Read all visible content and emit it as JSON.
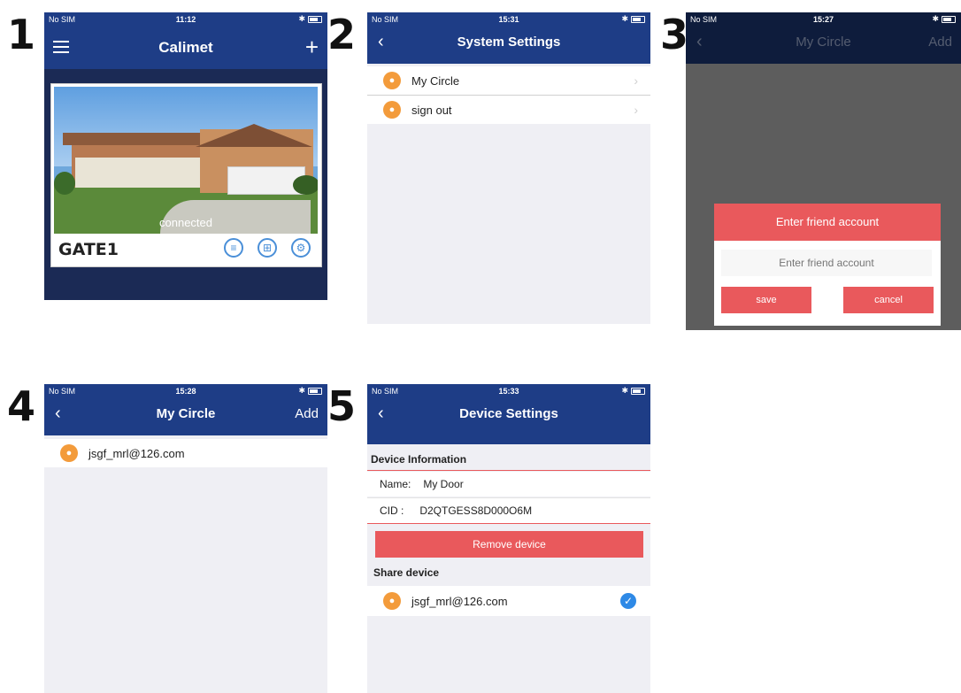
{
  "labels": [
    "1",
    "2",
    "3",
    "4",
    "5"
  ],
  "status": {
    "carrier": "No SIM",
    "time1": "11:12",
    "time2": "15:31",
    "time3": "15:27",
    "time4": "15:28",
    "time5": "15:33"
  },
  "screen1": {
    "title": "Calimet",
    "camera_status": "connected",
    "device_name": "GATE1"
  },
  "screen2": {
    "title": "System Settings",
    "items": [
      {
        "label": "My Circle",
        "icon": "group-icon"
      },
      {
        "label": "sign out",
        "icon": "person-icon"
      }
    ]
  },
  "screen3": {
    "title": "My Circle",
    "add": "Add",
    "dialog_title": "Enter friend account",
    "placeholder": "Enter friend account",
    "save": "save",
    "cancel": "cancel"
  },
  "screen4": {
    "title": "My Circle",
    "add": "Add",
    "friend": "jsgf_mrl@126.com"
  },
  "screen5": {
    "title": "Device Settings",
    "section_info": "Device Information",
    "name_label": "Name:",
    "name_value": "My Door",
    "cid_label": "CID :",
    "cid_value": "D2QTGESS8D000O6M",
    "remove": "Remove device",
    "section_share": "Share device",
    "friend": "jsgf_mrl@126.com"
  },
  "colors": {
    "nav": "#1e3d86",
    "app_bg": "#1b2a55",
    "accent_red": "#e9595c",
    "accent_blue": "#2e89e6",
    "orange": "#f39b3b"
  }
}
